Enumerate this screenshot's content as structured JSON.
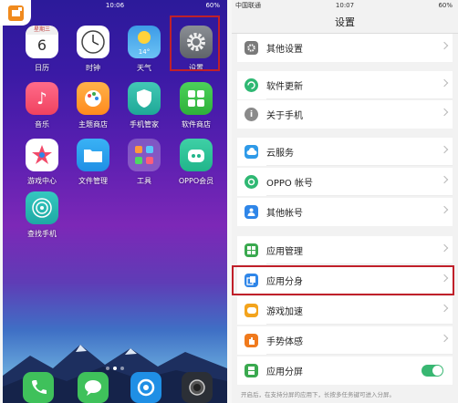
{
  "home": {
    "status": {
      "carrier": "",
      "time": "10:06",
      "battery": "60%"
    },
    "apps": [
      {
        "name": "calendar",
        "label": "日历",
        "day_label": "星期三",
        "date": "6"
      },
      {
        "name": "clock",
        "label": "时钟"
      },
      {
        "name": "weather",
        "label": "天气",
        "temp": "14°"
      },
      {
        "name": "settings",
        "label": "设置"
      },
      {
        "name": "music",
        "label": "音乐"
      },
      {
        "name": "theme-store",
        "label": "主题商店"
      },
      {
        "name": "phone-manager",
        "label": "手机管家"
      },
      {
        "name": "software-store",
        "label": "软件商店"
      },
      {
        "name": "game-center",
        "label": "游戏中心"
      },
      {
        "name": "file-manager",
        "label": "文件管理"
      },
      {
        "name": "tools",
        "label": "工具"
      },
      {
        "name": "oppo-member",
        "label": "OPPO会员"
      },
      {
        "name": "find-phone",
        "label": "查找手机"
      }
    ],
    "dock": [
      "phone",
      "messages",
      "browser",
      "camera"
    ],
    "colors": {
      "highlight": "#c0202a"
    }
  },
  "settings": {
    "status": {
      "carrier": "中国联通",
      "time": "10:07",
      "battery": "60%"
    },
    "title": "设置",
    "rows": [
      {
        "label": "其他设置",
        "icon": "gear-icon",
        "color": "#7a7a7a"
      },
      {
        "label": "软件更新",
        "icon": "refresh-icon",
        "color": "#2fb873"
      },
      {
        "label": "关于手机",
        "icon": "info-icon",
        "color": "#8a8a8a"
      },
      {
        "label": "云服务",
        "icon": "cloud-icon",
        "color": "#2f9ae8"
      },
      {
        "label": "OPPO 帐号",
        "icon": "account-icon",
        "color": "#2fb873"
      },
      {
        "label": "其他帐号",
        "icon": "person-icon",
        "color": "#2f86e8"
      },
      {
        "label": "应用管理",
        "icon": "apps-icon",
        "color": "#3aa94f"
      },
      {
        "label": "应用分身",
        "icon": "clone-icon",
        "color": "#2f86e8"
      },
      {
        "label": "游戏加速",
        "icon": "game-icon",
        "color": "#f3a41d"
      },
      {
        "label": "手势体感",
        "icon": "hand-icon",
        "color": "#f07a1d"
      },
      {
        "label": "应用分屏",
        "icon": "split-screen-icon",
        "color": "#3aa94f",
        "toggle": true
      }
    ],
    "footnote": "开启后，在支持分屏的应用下，长按多任务键可进入分屏。"
  }
}
